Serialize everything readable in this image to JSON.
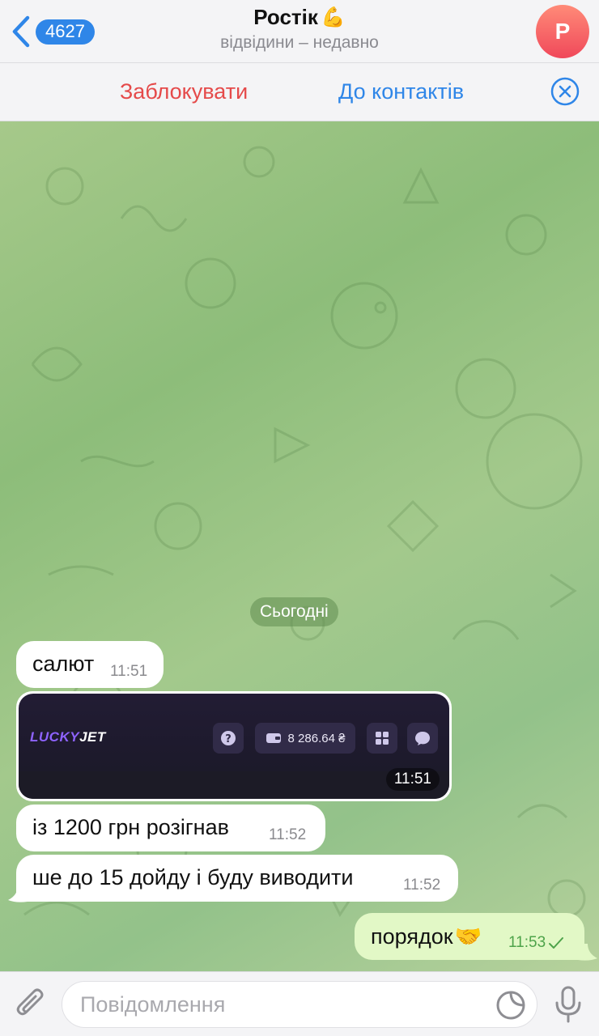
{
  "header": {
    "back_count": "4627",
    "title": "Ростік",
    "title_emoji": "💪",
    "subtitle": "відвідини – недавно",
    "avatar_letter": "Р"
  },
  "actions": {
    "block_label": "Заблокувати",
    "contacts_label": "До контактів"
  },
  "chat": {
    "date_separator": "Сьогодні",
    "messages": [
      {
        "text": "салют",
        "time": "11:51",
        "outgoing": false
      },
      {
        "type": "image",
        "time": "11:51",
        "image": {
          "logo_part1": "LUCKY",
          "logo_part2": "JET",
          "balance": "8 286.64 ₴"
        },
        "outgoing": false
      },
      {
        "text": "із 1200 грн розігнав",
        "time": "11:52",
        "outgoing": false
      },
      {
        "text": "ше до 15 дойду і буду виводити",
        "time": "11:52",
        "outgoing": false
      },
      {
        "text": "порядок",
        "emoji": "🤝",
        "time": "11:53",
        "outgoing": true,
        "status": "sent"
      }
    ]
  },
  "input": {
    "placeholder": "Повідомлення"
  },
  "colors": {
    "accent": "#2f86e8",
    "danger": "#e54a4a",
    "outgoing_bubble": "#e2f8c6",
    "chat_bg": "#9cc585"
  }
}
